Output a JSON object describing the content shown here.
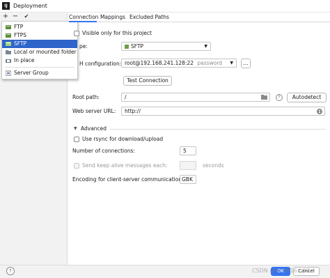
{
  "window": {
    "title": "Deployment"
  },
  "toolbar": {
    "add": "+",
    "remove": "−",
    "check": "✔"
  },
  "menu": {
    "items": [
      {
        "label": "FTP",
        "icon": "ftp-icon"
      },
      {
        "label": "FTPS",
        "icon": "ftps-icon"
      },
      {
        "label": "SFTP",
        "icon": "sftp-icon",
        "selected": true
      },
      {
        "label": "Local or mounted folder",
        "icon": "folder-icon"
      },
      {
        "label": "In place",
        "icon": "in-place-icon"
      },
      {
        "label": "Server Group",
        "icon": "server-group-icon"
      }
    ]
  },
  "tabs": [
    "Connection",
    "Mappings",
    "Excluded Paths"
  ],
  "connection": {
    "visible_only_label": "Visible only for this project",
    "type_label": "pe:",
    "type_value": "SFTP",
    "ssh_label": "H configuration:",
    "ssh_value": "root@192.168.241.128:22",
    "ssh_hint": "password",
    "ssh_more": "...",
    "test_button": "Test Connection",
    "root_path_label": "Root path:",
    "root_path_value": "/",
    "autodetect_button": "Autodetect",
    "web_url_label": "Web server URL:",
    "web_url_value": "http://",
    "advanced_label": "Advanced",
    "rsync_label": "Use rsync for download/upload",
    "connections_label": "Number of connections:",
    "connections_value": "5",
    "keepalive_label": "Send keep alive messages each:",
    "keepalive_unit": "seconds",
    "encoding_label": "Encoding for client-server communication:",
    "encoding_value": "GBK"
  },
  "footer": {
    "help": "?",
    "ok": "OK",
    "cancel": "Cancel",
    "watermark": "CSDN @lo_4816…53"
  },
  "colors": {
    "accent": "#3574f0",
    "selection": "#2f65ca"
  }
}
